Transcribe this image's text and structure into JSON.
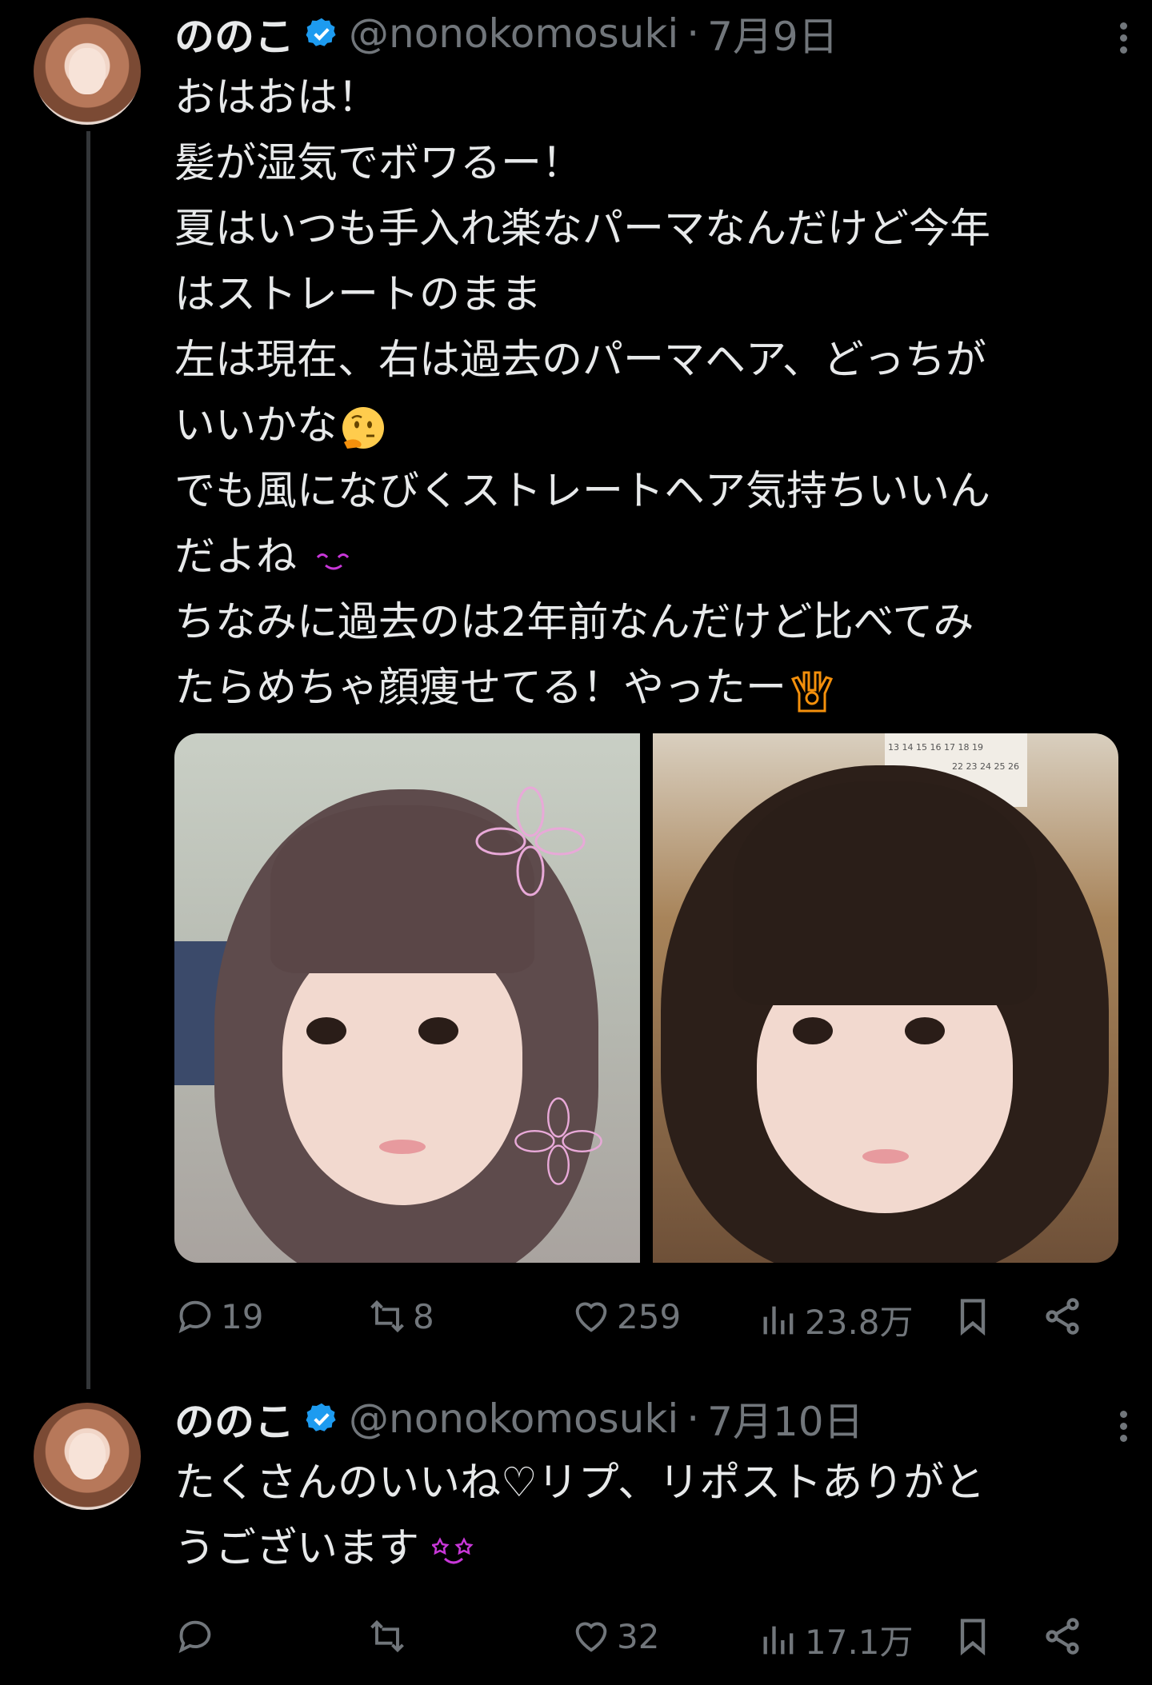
{
  "tweets": [
    {
      "name": "ののこ",
      "handle": "@nonokomosuki",
      "separator": "·",
      "date": "7月9日",
      "lines": [
        "おはおは！",
        "髪が湿気でボワるー！",
        "夏はいつも手入れ楽なパーマなんだけど今年",
        "はストレートのまま",
        "左は現在、右は過去のパーマヘア、どっちが",
        "いいかな",
        "でも風になびくストレートヘア気持ちいいん",
        "だよね",
        "ちなみに過去のは2年前なんだけど比べてみ",
        "たらめちゃ顔痩せてる！やったー"
      ],
      "emojis": [
        "thinking-face-emoji",
        "smiling-eyes-emoji",
        "raising-hands-emoji"
      ],
      "calendar_numbers": [
        "13 14 15 16 17 18 19",
        "22 23 24 25 26"
      ],
      "replies": "19",
      "reposts": "8",
      "likes": "259",
      "views": "23.8万"
    },
    {
      "name": "ののこ",
      "handle": "@nonokomosuki",
      "separator": "·",
      "date": "7月10日",
      "lines": [
        "たくさんのいいね♡リプ、リポストありがと ",
        "うございます"
      ],
      "emojis": [
        "star-struck-face-emoji"
      ],
      "replies": "",
      "reposts": "",
      "likes": "32",
      "views": "17.1万"
    }
  ],
  "colors": {
    "background": "#000000",
    "text": "#e7e9ea",
    "muted": "#71767b",
    "verified": "#1d9bf0",
    "divider": "#333639"
  }
}
